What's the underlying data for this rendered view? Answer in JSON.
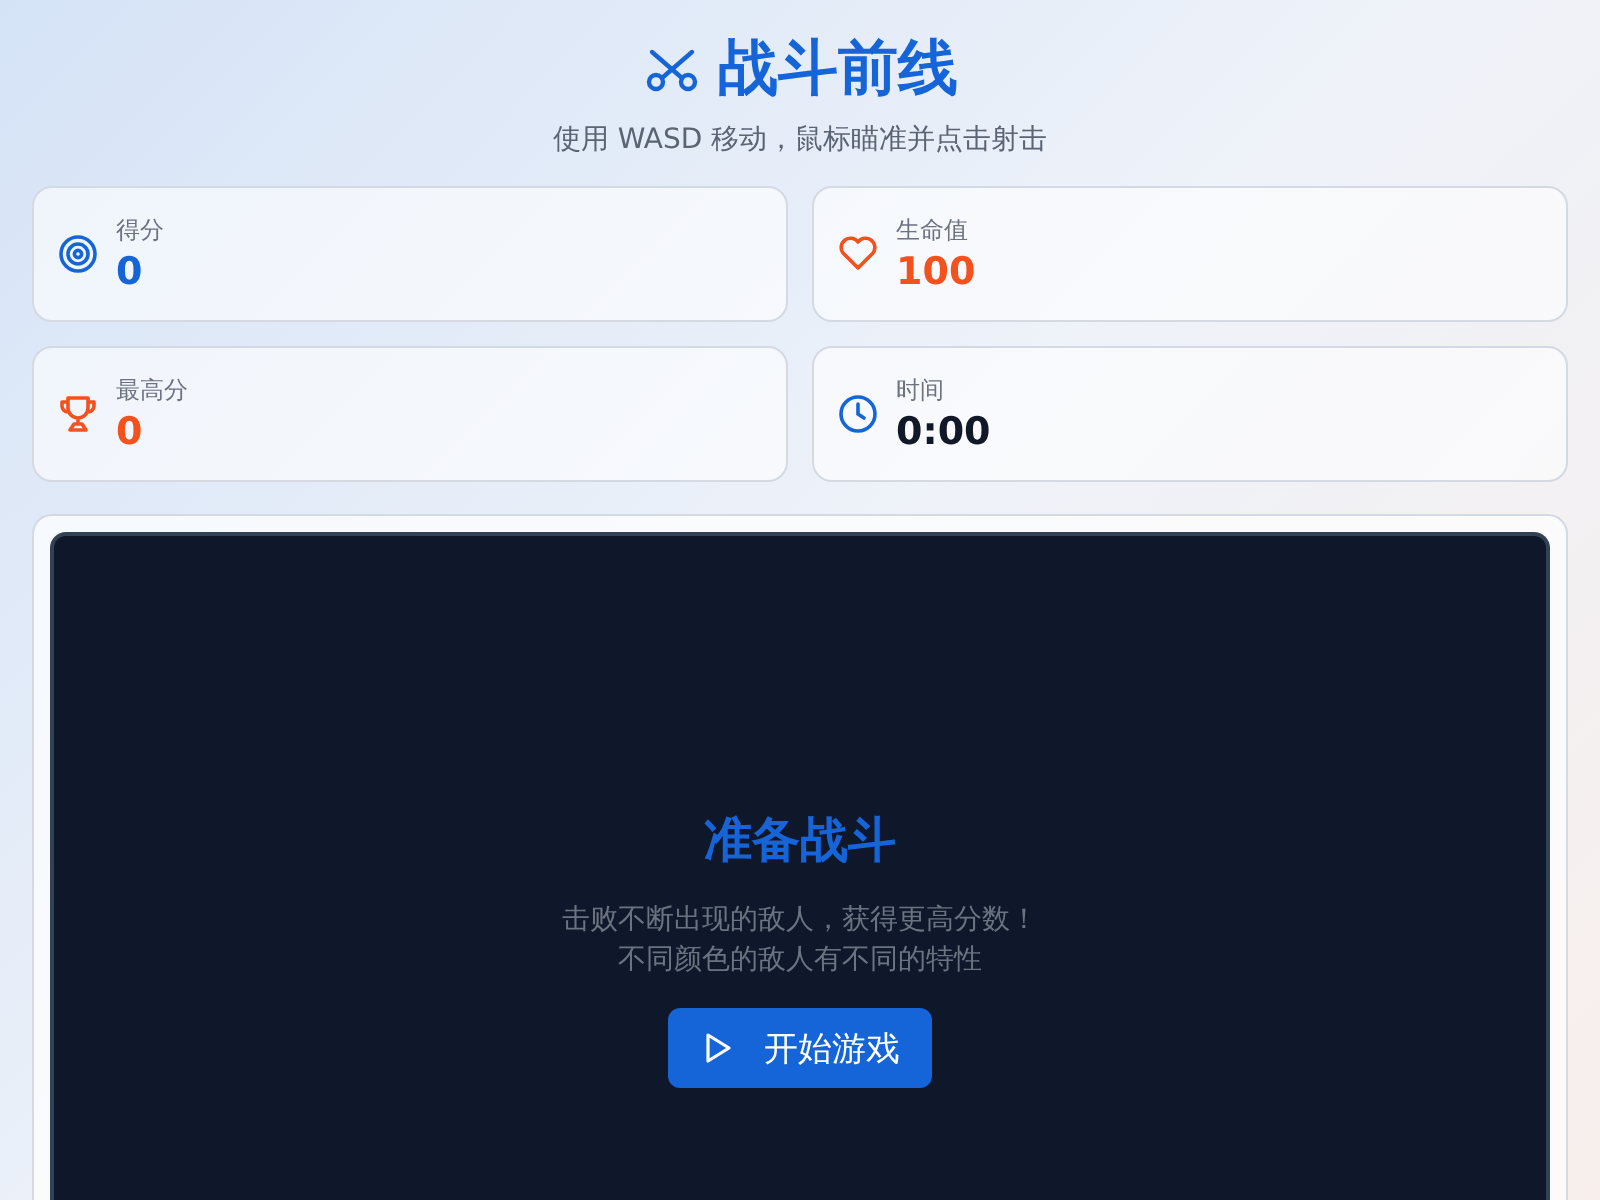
{
  "header": {
    "title": "战斗前线",
    "subtitle": "使用 WASD 移动，鼠标瞄准并点击射击"
  },
  "stats": [
    {
      "kind": "target",
      "label": "得分",
      "value": "0",
      "color": "#1565d8"
    },
    {
      "kind": "heart",
      "label": "生命值",
      "value": "100",
      "color": "#f4511e"
    },
    {
      "kind": "trophy",
      "label": "最高分",
      "value": "0",
      "color": "#f4511e"
    },
    {
      "kind": "clock",
      "label": "时间",
      "value": "0:00",
      "color": "#111827"
    }
  ],
  "game": {
    "title": "准备战斗",
    "description": [
      "击败不断出现的敌人，获得更高分数！",
      "不同颜色的敌人有不同的特性"
    ],
    "start_button": "开始游戏"
  }
}
